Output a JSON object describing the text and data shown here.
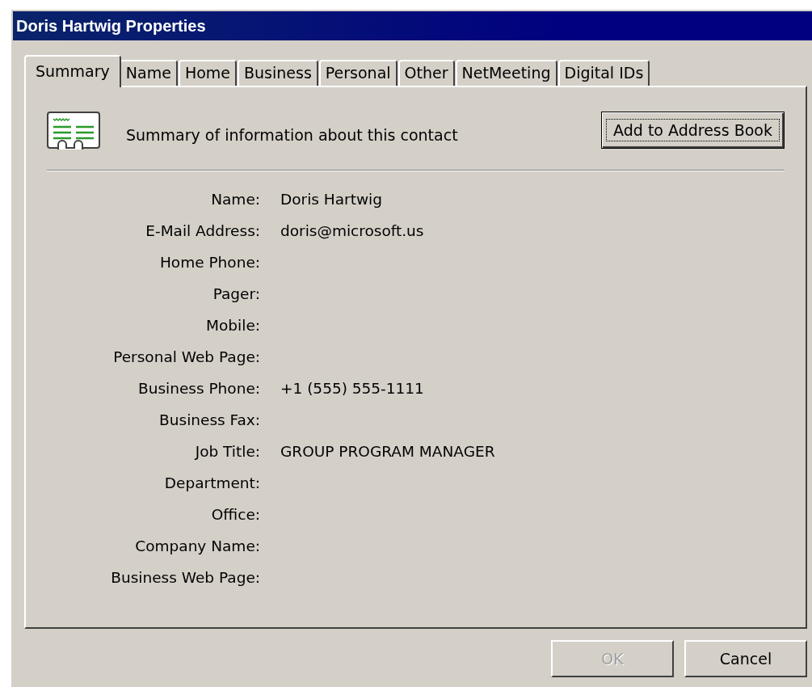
{
  "window": {
    "title": "Doris Hartwig Properties"
  },
  "tabs": [
    {
      "label": "Summary",
      "selected": true
    },
    {
      "label": "Name",
      "selected": false
    },
    {
      "label": "Home",
      "selected": false
    },
    {
      "label": "Business",
      "selected": false
    },
    {
      "label": "Personal",
      "selected": false
    },
    {
      "label": "Other",
      "selected": false
    },
    {
      "label": "NetMeeting",
      "selected": false
    },
    {
      "label": "Digital IDs",
      "selected": false
    }
  ],
  "header": {
    "text": "Summary of information about this contact",
    "button": {
      "label": "Add to Address Book",
      "focused": true
    }
  },
  "fields": [
    {
      "label": "Name:",
      "value": "Doris Hartwig"
    },
    {
      "label": "E-Mail Address:",
      "value": "doris@microsoft.us"
    },
    {
      "label": "Home Phone:"
    },
    {
      "label": "Pager:"
    },
    {
      "label": "Mobile:"
    },
    {
      "label": "Personal Web Page:"
    },
    {
      "label": "Business Phone:",
      "value": "+1 (555) 555-1111"
    },
    {
      "label": "Business Fax:"
    },
    {
      "label": "Job Title:",
      "value": "GROUP PROGRAM MANAGER"
    },
    {
      "label": "Department:"
    },
    {
      "label": "Office:"
    },
    {
      "label": "Company Name:"
    },
    {
      "label": "Business Web Page:"
    }
  ],
  "buttons": [
    {
      "label": "OK",
      "disabled": true
    },
    {
      "label": "Cancel",
      "disabled": false
    }
  ]
}
